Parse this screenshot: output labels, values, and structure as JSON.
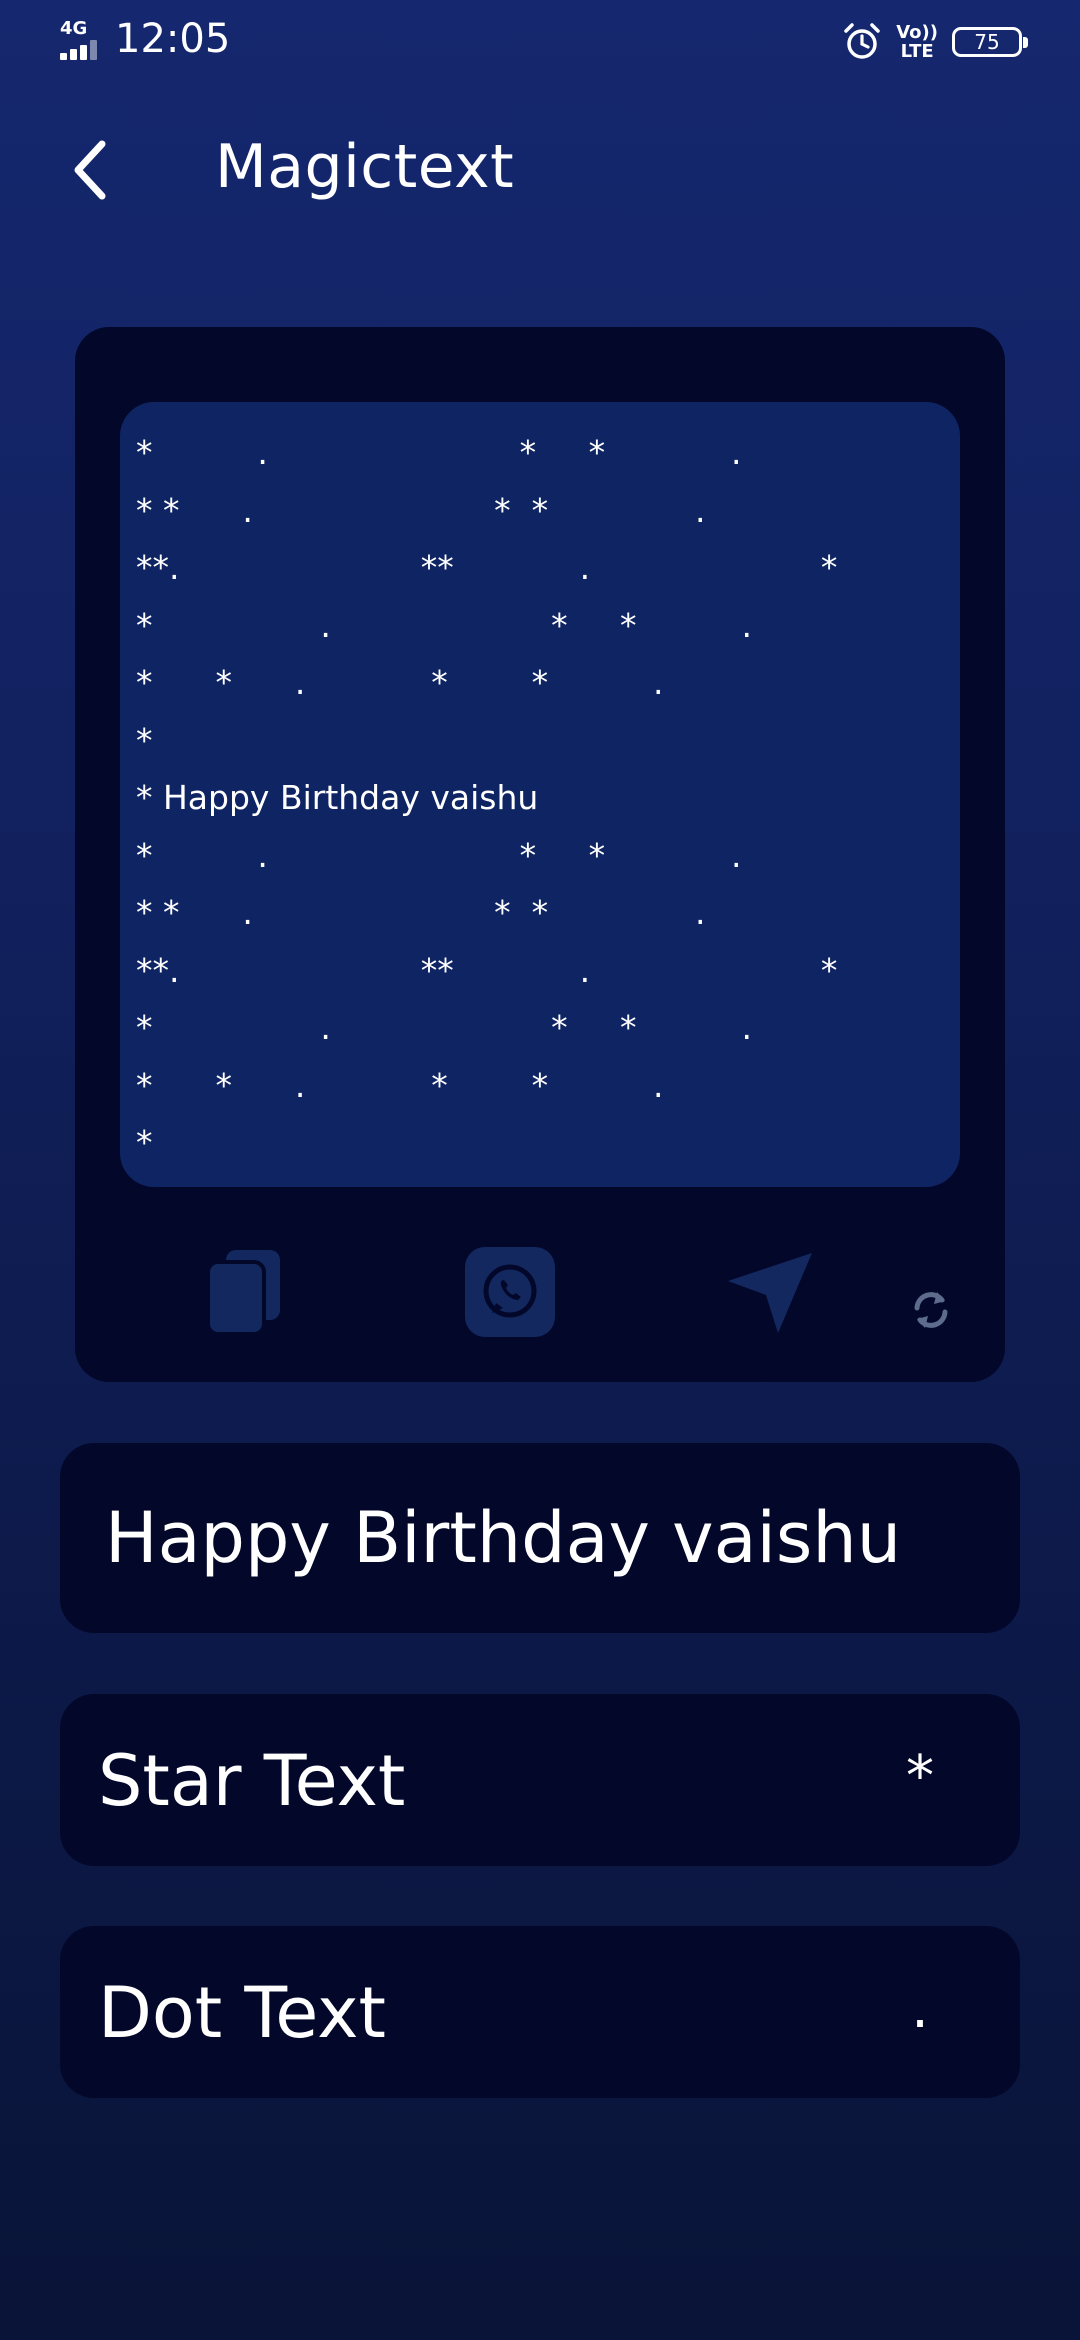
{
  "status_bar": {
    "network": "4G",
    "time": "12:05",
    "volte_top": "Vo))",
    "volte_bottom": "LTE",
    "battery": "75",
    "signal_icon": "signal-icon",
    "alarm_icon": "alarm-icon"
  },
  "header": {
    "title": "Magictext",
    "back_icon": "chevron-left-icon"
  },
  "preview": {
    "text": "*          .                        *     *            .\n* *      .                       *  *              .\n**.                       **            .                      *\n*                .                     *     *          .\n*      *      .            *        *          .\n*\n* Happy Birthday vaishu\n*          .                        *     *            .\n* *      .                       *  *              .\n**.                       **            .                      *\n*                .                     *     *          .\n*      *      .            *        *          .\n*",
    "actions": {
      "copy_icon": "copy-icon",
      "whatsapp_icon": "whatsapp-icon",
      "share_icon": "send-icon",
      "refresh_icon": "refresh-icon"
    }
  },
  "inputs": {
    "message_value": "Happy Birthday vaishu",
    "star_label": "Star Text",
    "star_value": "*",
    "dot_label": "Dot Text",
    "dot_value": "."
  },
  "colors": {
    "background_top": "#15276e",
    "background_bottom": "#0a1438",
    "card": "#03082b",
    "preview_box": "#0f2462",
    "icon_muted": "#13285f",
    "text": "#ffffff"
  }
}
